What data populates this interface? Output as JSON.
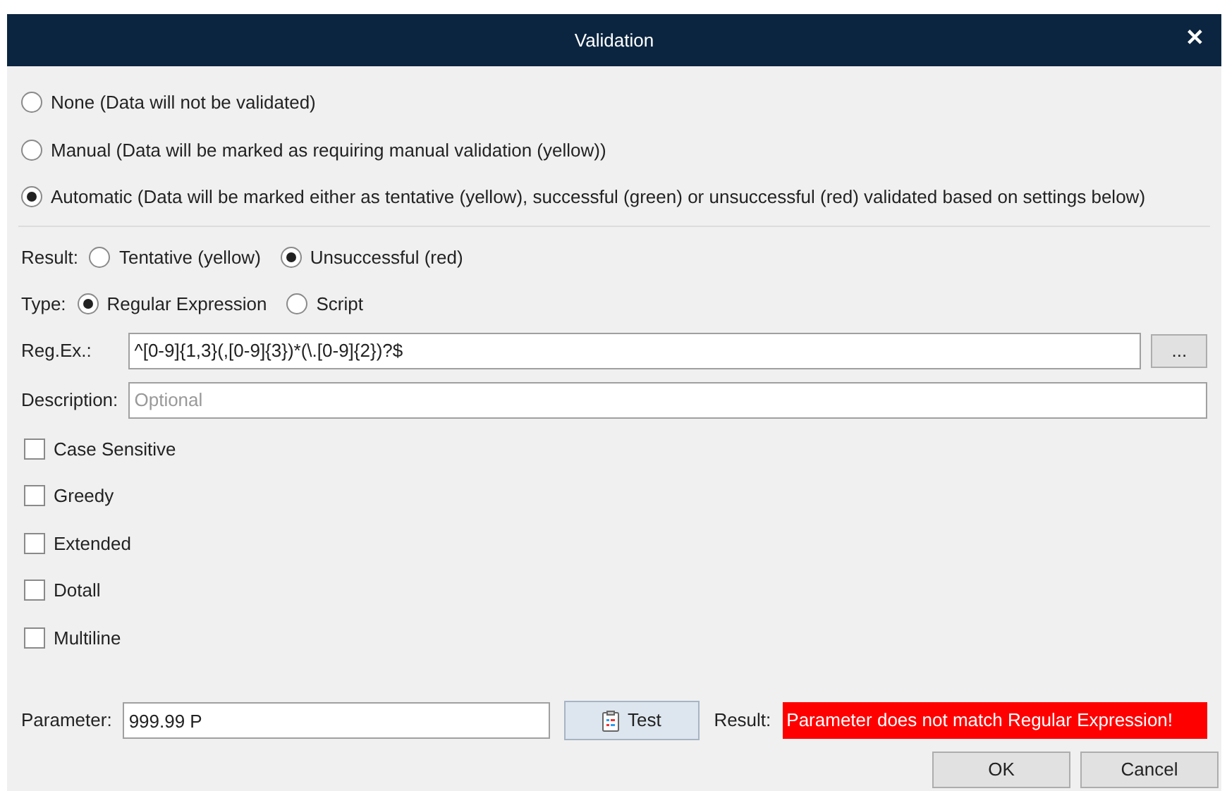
{
  "window": {
    "title": "Validation",
    "close": "✕"
  },
  "modes": [
    {
      "label": "None (Data will not be validated)",
      "selected": false
    },
    {
      "label": "Manual (Data will be marked as requiring manual validation (yellow))",
      "selected": false
    },
    {
      "label": "Automatic (Data will be marked either as tentative (yellow), successful (green) or unsuccessful (red) validated based on settings below)",
      "selected": true
    }
  ],
  "result": {
    "label": "Result:",
    "options": [
      {
        "label": "Tentative (yellow)",
        "selected": false
      },
      {
        "label": "Unsuccessful (red)",
        "selected": true
      }
    ]
  },
  "type": {
    "label": "Type:",
    "options": [
      {
        "label": "Regular Expression",
        "selected": true
      },
      {
        "label": "Script",
        "selected": false
      }
    ]
  },
  "regex": {
    "label": "Reg.Ex.:",
    "value": "^[0-9]{1,3}(,[0-9]{3})*(\\.[0-9]{2})?$",
    "browse": "..."
  },
  "description": {
    "label": "Description:",
    "placeholder": "Optional"
  },
  "options": [
    {
      "label": "Case Sensitive",
      "checked": false
    },
    {
      "label": "Greedy",
      "checked": false
    },
    {
      "label": "Extended",
      "checked": false
    },
    {
      "label": "Dotall",
      "checked": false
    },
    {
      "label": "Multiline",
      "checked": false
    }
  ],
  "test": {
    "label": "Parameter:",
    "value": "999.99 P",
    "button": "Test",
    "result_label": "Result:",
    "result": "Parameter does not match Regular Expression!",
    "success": false
  },
  "buttons": [
    "OK",
    "Cancel"
  ]
}
